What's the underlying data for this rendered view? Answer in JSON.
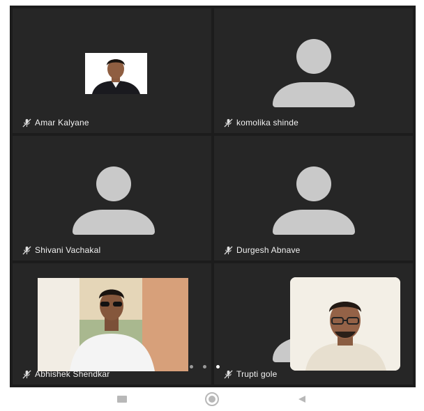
{
  "participants": [
    {
      "name": "Amar Kalyane",
      "video": "photo",
      "muted": true
    },
    {
      "name": "komolika shinde",
      "video": "avatar",
      "muted": true
    },
    {
      "name": "Shivani Vachakal",
      "video": "avatar",
      "muted": true
    },
    {
      "name": "Durgesh Abnave",
      "video": "avatar",
      "muted": true
    },
    {
      "name": "Abhishek Shendkar",
      "video": "photo",
      "muted": true
    },
    {
      "name": "Trupti gole",
      "video": "avatar",
      "muted": true
    }
  ],
  "self_view": {
    "video": "camera"
  },
  "page_indicator": {
    "pages": 3,
    "current": 3
  },
  "nav_bar": {
    "buttons": [
      "recents-icon",
      "home-icon",
      "back-icon"
    ]
  },
  "colors": {
    "tile_bg": "#262626",
    "grid_bg": "#1c1c1c",
    "avatar": "#c9c9c9",
    "name_text": "#f2f2f2",
    "mic_muted": "#e0e0e0"
  }
}
